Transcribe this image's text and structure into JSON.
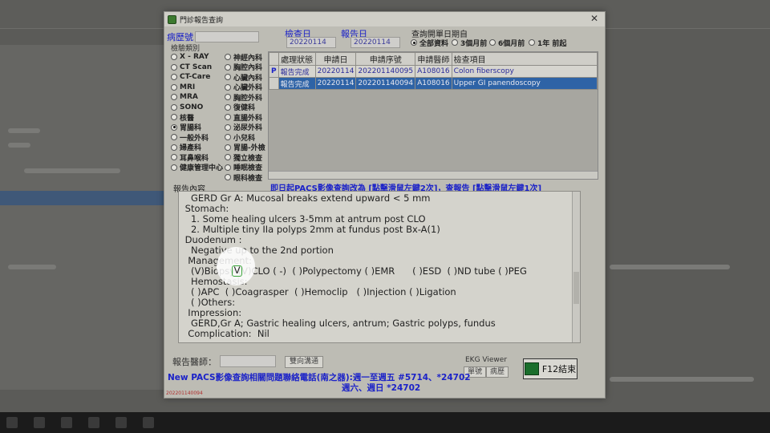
{
  "window": {
    "title": "門診報告查詢"
  },
  "patient": {
    "id_label": "病歷號",
    "id_value": ""
  },
  "dates": {
    "exam_date_label": "檢查日",
    "exam_date_value": "20220114",
    "report_date_label": "報告日",
    "report_date_value": "20220114"
  },
  "query_range": {
    "label": "查詢開單日期自",
    "options": [
      {
        "label": "全部資料",
        "selected": true
      },
      {
        "label": "3個月前",
        "selected": false
      },
      {
        "label": "6個月前",
        "selected": false
      },
      {
        "label": "1年 前起",
        "selected": false
      }
    ]
  },
  "exam_category": {
    "label": "檢驗類別",
    "left": [
      {
        "label": "X - RAY",
        "selected": false
      },
      {
        "label": "CT Scan",
        "selected": false
      },
      {
        "label": "CT-Care",
        "selected": false
      },
      {
        "label": "MRI",
        "selected": false
      },
      {
        "label": "MRA",
        "selected": false
      },
      {
        "label": "SONO",
        "selected": false
      },
      {
        "label": "核醫",
        "selected": false
      },
      {
        "label": "胃腸科",
        "selected": true
      },
      {
        "label": "一般外科",
        "selected": false
      },
      {
        "label": "婦產科",
        "selected": false
      },
      {
        "label": "耳鼻喉科",
        "selected": false
      },
      {
        "label": "健康管理中心",
        "selected": false
      }
    ],
    "right": [
      {
        "label": "神經內科",
        "selected": false
      },
      {
        "label": "胸腔內科",
        "selected": false
      },
      {
        "label": "心臟內科",
        "selected": false
      },
      {
        "label": "心臟外科",
        "selected": false
      },
      {
        "label": "胸腔外科",
        "selected": false
      },
      {
        "label": "復健科",
        "selected": false
      },
      {
        "label": "直腸外科",
        "selected": false
      },
      {
        "label": "泌尿外科",
        "selected": false
      },
      {
        "label": "小兒科",
        "selected": false
      },
      {
        "label": "胃腸-外檢",
        "selected": false
      },
      {
        "label": "獨立檢查",
        "selected": false
      },
      {
        "label": "睡眠檢查",
        "selected": false
      },
      {
        "label": "眼科檢查",
        "selected": false
      }
    ]
  },
  "orders": {
    "columns": [
      "處理狀態",
      "申請日",
      "申請序號",
      "申請醫師",
      "檢查項目"
    ],
    "rows": [
      {
        "indicator": "P",
        "status": "報告完成",
        "date": "20220114",
        "serial": "202201140095",
        "doctor": "A108016",
        "item": "Colon fiberscopy",
        "selected": false
      },
      {
        "indicator": "",
        "status": "報告完成",
        "date": "20220114",
        "serial": "202201140094",
        "doctor": "A108016",
        "item": "Upper GI panendoscopy",
        "selected": true
      }
    ]
  },
  "notice": "即日起PACS影像查詢改為 [點擊滑鼠左鍵2次]，查報告 [點擊滑鼠左鍵1次]",
  "report": {
    "label": "報告內容",
    "lines": [
      "   GERD Gr A: Mucosal breaks extend upward < 5 mm",
      " Stomach:",
      "   1. Some healing ulcers 3-5mm at antrum post CLO",
      "   2. Multiple tiny IIa polyps 2mm at fundus post Bx-A(1)",
      " Duodenum :",
      "   Negative up to the 2nd portion",
      "  Management:",
      "   (V)Biopsy (V)CLO ( -)  ( )Polypectomy ( )EMR      ( )ESD  ( )ND tube ( )PEG",
      "   Hemostasis:",
      "   ( )APC  ( )Coagrasper  ( )Hemoclip   ( )Injection ( )Ligation",
      "   ( )Others:",
      "  Impression:",
      "   GERD,Gr A; Gastric healing ulcers, antrum; Gastric polyps, fundus",
      "  Complication:  Nil"
    ]
  },
  "footer": {
    "reporter_label": "報告醫師：",
    "reporter_value": "",
    "comm_button": "雙向溝通",
    "ekg_label": "EKG Viewer",
    "ekg_single": "單號",
    "ekg_history": "病歷",
    "close_button": "F12結束",
    "pacs_line1": "New PACS影像查詢相關問題聯絡電話(南之器):週一至週五 #5714、*24702",
    "pacs_line2": "週六、週日 *24702",
    "serial_text": "202201140094"
  }
}
